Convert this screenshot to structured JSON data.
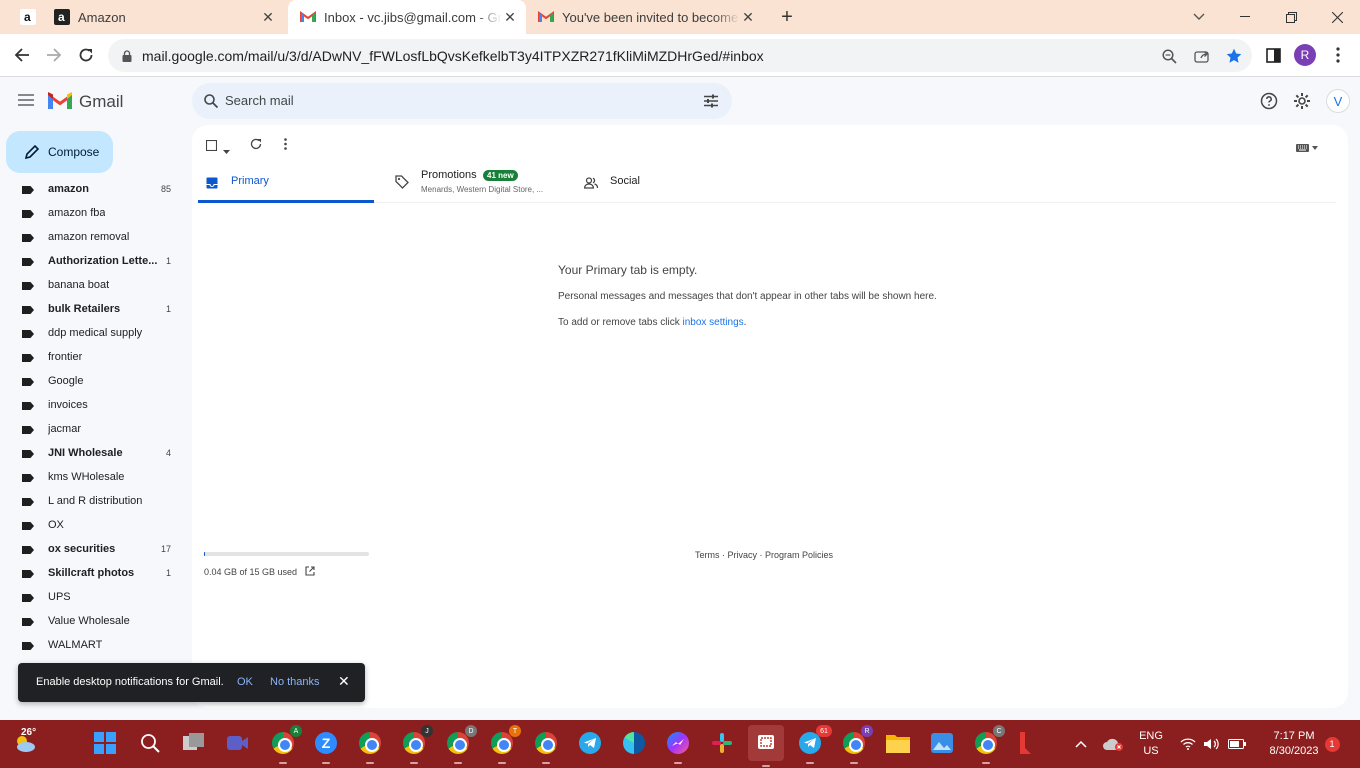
{
  "browser": {
    "tabs": [
      {
        "title": "Amazon"
      },
      {
        "title": "Inbox - vc.jibs@gmail.com - Gmail"
      },
      {
        "title": "You've been invited to become a"
      }
    ],
    "url": "mail.google.com/mail/u/3/d/ADwNV_fFWLosfLbQvsKefkelbT3y4ITPXZR271fKliMiMZDHrGed/#inbox",
    "profile_initial": "R"
  },
  "gmail": {
    "logo_text": "Gmail",
    "search_placeholder": "Search mail",
    "account_initial": "V",
    "compose_label": "Compose",
    "labels": [
      {
        "name": "amazon",
        "count": "85",
        "bold": true
      },
      {
        "name": "amazon fba",
        "count": "",
        "bold": false
      },
      {
        "name": "amazon removal",
        "count": "",
        "bold": false
      },
      {
        "name": "Authorization Lette...",
        "count": "1",
        "bold": true
      },
      {
        "name": "banana boat",
        "count": "",
        "bold": false
      },
      {
        "name": "bulk Retailers",
        "count": "1",
        "bold": true
      },
      {
        "name": "ddp medical supply",
        "count": "",
        "bold": false
      },
      {
        "name": "frontier",
        "count": "",
        "bold": false
      },
      {
        "name": "Google",
        "count": "",
        "bold": false
      },
      {
        "name": "invoices",
        "count": "",
        "bold": false
      },
      {
        "name": "jacmar",
        "count": "",
        "bold": false
      },
      {
        "name": "JNI Wholesale",
        "count": "4",
        "bold": true
      },
      {
        "name": "kms WHolesale",
        "count": "",
        "bold": false
      },
      {
        "name": "L and R distribution",
        "count": "",
        "bold": false
      },
      {
        "name": "OX",
        "count": "",
        "bold": false
      },
      {
        "name": "ox securities",
        "count": "17",
        "bold": true
      },
      {
        "name": "Skillcraft photos",
        "count": "1",
        "bold": true
      },
      {
        "name": "UPS",
        "count": "",
        "bold": false
      },
      {
        "name": "Value Wholesale",
        "count": "",
        "bold": false
      },
      {
        "name": "WALMART",
        "count": "",
        "bold": false
      }
    ],
    "inbox_tabs": {
      "primary": "Primary",
      "promotions": "Promotions",
      "promotions_badge": "41 new",
      "promotions_sub": "Menards, Western Digital Store, ...",
      "social": "Social"
    },
    "empty_state": {
      "heading": "Your Primary tab is empty.",
      "line1": "Personal messages and messages that don't appear in other tabs will be shown here.",
      "line2_prefix": "To add or remove tabs click ",
      "line2_link": "inbox settings",
      "line2_suffix": "."
    },
    "storage_text": "0.04 GB of 15 GB used",
    "storage_fraction": 0.0027,
    "footer": {
      "terms": "Terms",
      "sep1": " · ",
      "privacy": "Privacy",
      "sep2": " · ",
      "policies": "Program Policies"
    },
    "snackbar": {
      "message": "Enable desktop notifications for Gmail.",
      "ok": "OK",
      "no_thanks": "No thanks"
    }
  },
  "taskbar": {
    "weather_temp": "26°",
    "lang": "ENG",
    "region": "US",
    "time": "7:17 PM",
    "date": "8/30/2023",
    "notification_count": "1",
    "telegram_badge": "61",
    "badges": {
      "chrome_a": "A",
      "chrome_d": "D",
      "chrome_t": "T",
      "chrome_j": "J",
      "chrome_r": "R",
      "chrome_c": "C"
    }
  },
  "colors": {
    "tabstrip": "#fbe3d3",
    "taskbar": "#8b1f1f",
    "compose": "#c2e7ff",
    "primary_blue": "#0b57d0",
    "badge_green": "#188038"
  }
}
